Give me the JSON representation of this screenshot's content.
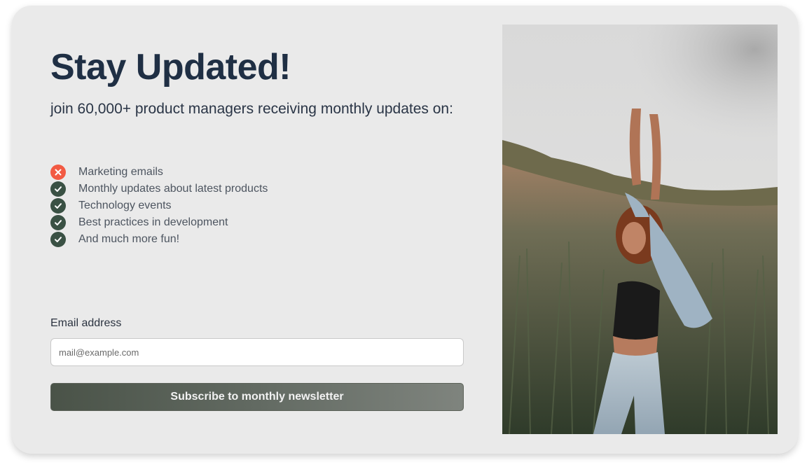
{
  "hero": {
    "title": "Stay Updated!",
    "subtitle": "join 60,000+ product managers receiving monthly updates on:"
  },
  "features": [
    {
      "label": "Marketing emails",
      "icon": "x-circle-icon",
      "status": "excluded"
    },
    {
      "label": "Monthly updates about latest products",
      "icon": "check-circle-icon",
      "status": "included"
    },
    {
      "label": "Technology events",
      "icon": "check-circle-icon",
      "status": "included"
    },
    {
      "label": "Best practices in development",
      "icon": "check-circle-icon",
      "status": "included"
    },
    {
      "label": "And much more fun!",
      "icon": "check-circle-icon",
      "status": "included"
    }
  ],
  "form": {
    "email_label": "Email address",
    "email_placeholder": "mail@example.com",
    "email_value": "",
    "submit_label": "Subscribe to monthly newsletter"
  },
  "colors": {
    "card_background": "#eaeaea",
    "title": "#1f2f44",
    "check_icon": "#3a5144",
    "cross_icon": "#f25a43",
    "button_gradient_start": "#4a5348",
    "button_gradient_end": "#7f847e"
  }
}
